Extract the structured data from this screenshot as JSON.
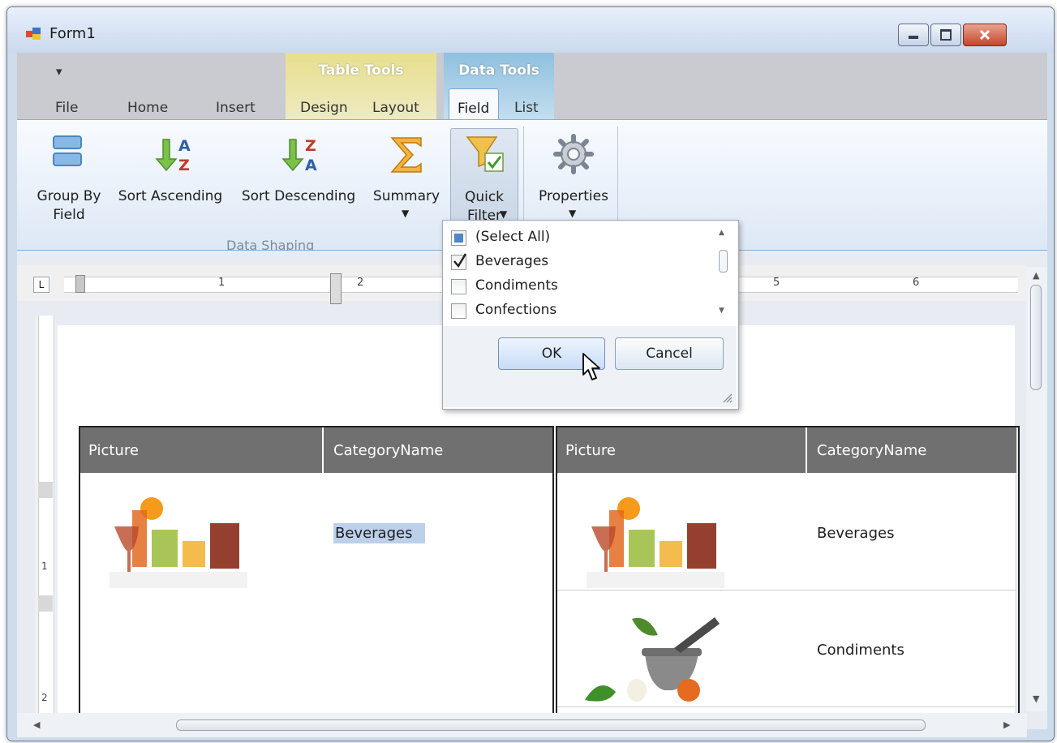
{
  "window": {
    "title": "Form1"
  },
  "ribbon": {
    "quick_access": "▾",
    "context_groups": [
      {
        "label": "Table Tools",
        "color": "#e8e29a"
      },
      {
        "label": "Data Tools",
        "color": "#a9cfe6"
      }
    ],
    "tabs": [
      "File",
      "Home",
      "Insert",
      "Design",
      "Layout",
      "Field",
      "List"
    ],
    "active_tab": "Field",
    "buttons": {
      "group_by": "Group By\nField",
      "sort_asc": "Sort Ascending",
      "sort_desc": "Sort Descending",
      "summary": "Summary",
      "quick_filter": "Quick\nFilter",
      "properties": "Properties"
    },
    "group_label": "Data Shaping"
  },
  "ruler": {
    "h_numbers": [
      "1",
      "2",
      "5",
      "6"
    ],
    "v_numbers": [
      "1",
      "2"
    ]
  },
  "filter_popup": {
    "items": [
      {
        "label": "(Select All)",
        "state": "indeterminate"
      },
      {
        "label": "Beverages",
        "state": "checked"
      },
      {
        "label": "Condiments",
        "state": "unchecked"
      },
      {
        "label": "Confections",
        "state": "unchecked"
      }
    ],
    "ok_label": "OK",
    "cancel_label": "Cancel"
  },
  "document": {
    "tables": [
      {
        "headers": [
          "Picture",
          "CategoryName"
        ],
        "rows": [
          {
            "image": "beverages-image",
            "name": "Beverages"
          }
        ]
      },
      {
        "headers": [
          "Picture",
          "CategoryName"
        ],
        "rows": [
          {
            "image": "beverages-image",
            "name": "Beverages"
          },
          {
            "image": "condiments-image",
            "name": "Condiments"
          }
        ]
      }
    ]
  },
  "colors": {
    "accent": "#86aed8",
    "table_header": "#707070",
    "selection": "#bcd0eb"
  }
}
